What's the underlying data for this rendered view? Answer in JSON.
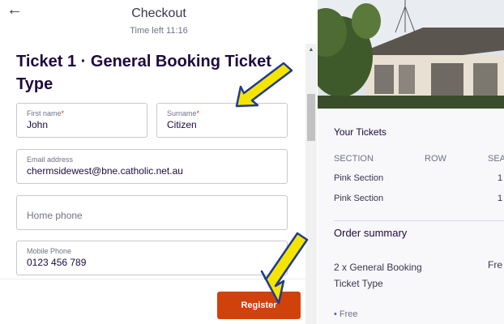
{
  "header": {
    "back_icon": "arrow-left-icon",
    "title": "Checkout",
    "timer": "Time left 11:16"
  },
  "form": {
    "ticket_title": "Ticket 1 · General Booking Ticket Type",
    "first_name": {
      "label": "First name",
      "required": "*",
      "value": "John"
    },
    "surname": {
      "label": "Surname",
      "required": "*",
      "value": "Citizen"
    },
    "email": {
      "label": "Email address",
      "value": "chermsidewest@bne.catholic.net.au"
    },
    "home_phone": {
      "placeholder": "Home phone"
    },
    "mobile_phone": {
      "label": "Mobile Phone",
      "value": "0123 456 789"
    },
    "register_label": "Register"
  },
  "sidebar": {
    "your_tickets": "Your Tickets",
    "columns": [
      "SECTION",
      "ROW",
      "SEA"
    ],
    "rows": [
      {
        "section": "Pink Section",
        "seat": "1"
      },
      {
        "section": "Pink Section",
        "seat": "1"
      }
    ],
    "order_summary": "Order summary",
    "order_item": "2 x General Booking Ticket Type",
    "order_price": "Fre",
    "bullet": "Free"
  },
  "colors": {
    "accent": "#d1410c",
    "annotation_arrow": "#f5e400",
    "annotation_outline": "#1f3a93"
  }
}
